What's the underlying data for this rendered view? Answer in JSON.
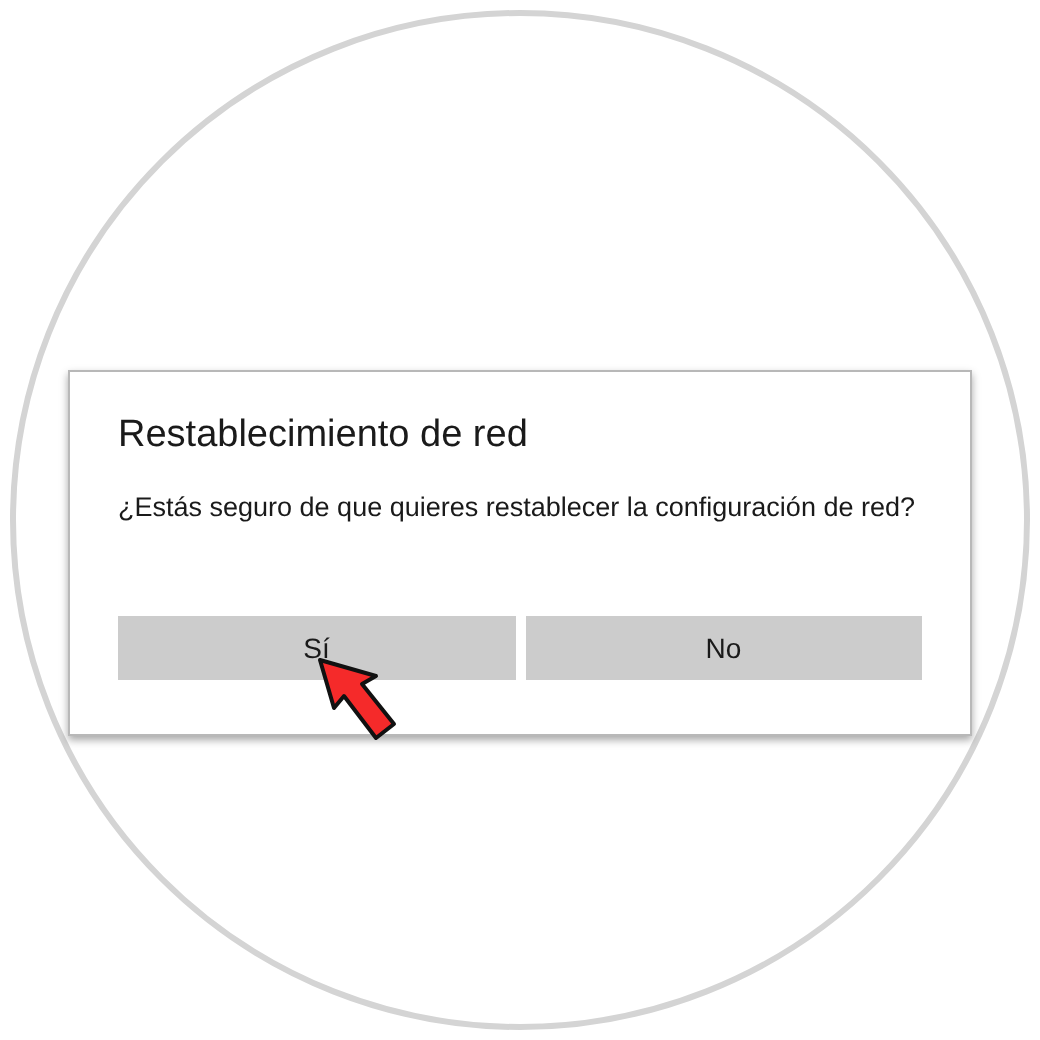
{
  "dialog": {
    "title": "Restablecimiento de red",
    "message": "¿Estás seguro de que quieres restablecer la configuración de red?",
    "buttons": [
      {
        "label": "Sí",
        "pointed": true
      },
      {
        "label": "No",
        "pointed": false
      }
    ]
  }
}
